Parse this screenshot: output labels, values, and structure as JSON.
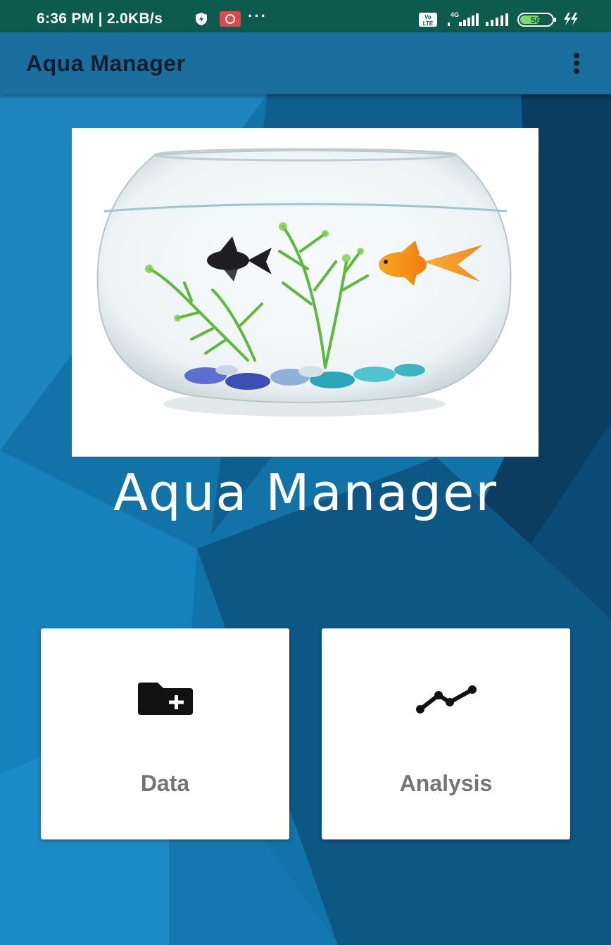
{
  "status_bar": {
    "time": "6:36 PM | 2.0KB/s",
    "dots": "···",
    "network_type": "4G",
    "volte": "Vo LTE",
    "battery": "56"
  },
  "app_bar": {
    "title": "Aqua Manager",
    "menu_icon": "more-vert-icon"
  },
  "hero": {
    "image_name": "fishbowl-image",
    "title": "Aqua Manager"
  },
  "cards": [
    {
      "label": "Data",
      "icon": "folder-add-icon"
    },
    {
      "label": "Analysis",
      "icon": "timeline-icon"
    }
  ],
  "colors": {
    "status_bar": "#0d5a4e",
    "app_bar": "#1a6e9e",
    "background": "#0f6fa3",
    "card_label": "#757575"
  }
}
